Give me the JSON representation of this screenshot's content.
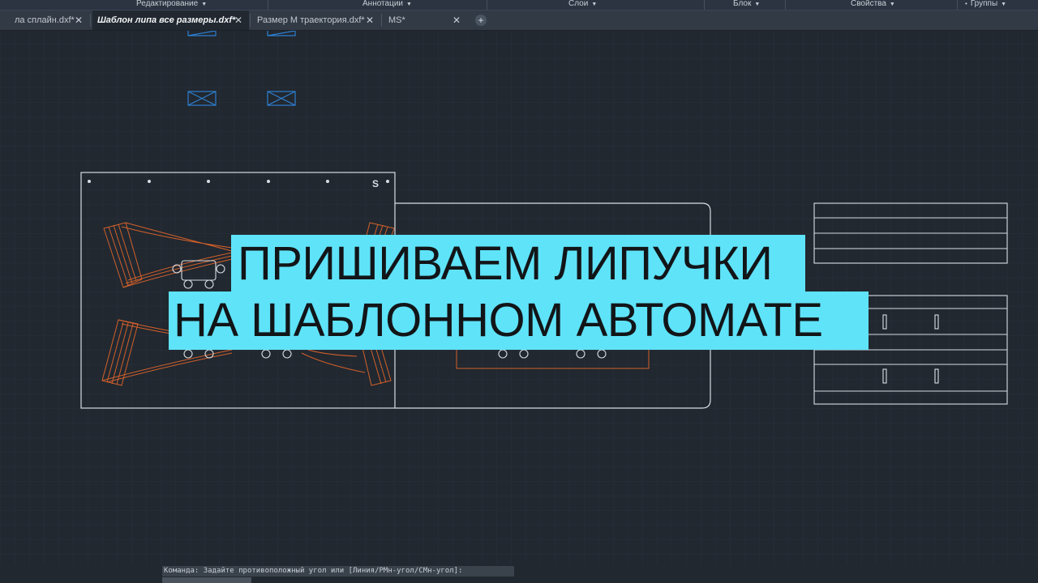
{
  "ribbon": {
    "panels": [
      "Редактирование",
      "Аннотации",
      "Слои",
      "Блок",
      "Свойства",
      "Группы"
    ]
  },
  "tabs": [
    {
      "label": "ла сплайн.dxf*",
      "active": false
    },
    {
      "label": "Шаблон липа все размеры.dxf*",
      "active": true
    },
    {
      "label": "Размер М траектория.dxf*",
      "active": false
    },
    {
      "label": "MS*",
      "active": false
    }
  ],
  "tab_close_glyph": "✕",
  "tab_add_glyph": "+",
  "drawing": {
    "marker": "S",
    "line_color": "#d8dde3",
    "orange_color": "#d3602a",
    "blue_color": "#2e7fd0",
    "grid_color": "#2a323c"
  },
  "overlay": {
    "line1": "ПРИШИВАЕМ ЛИПУЧКИ",
    "line2": "НА ШАБЛОННОМ АВТОМАТЕ",
    "background": "#5fe3f9"
  },
  "command": {
    "text": "Команда: Задайте противоположный угол или [Линия/РМн-угол/СМн-угол]:"
  }
}
